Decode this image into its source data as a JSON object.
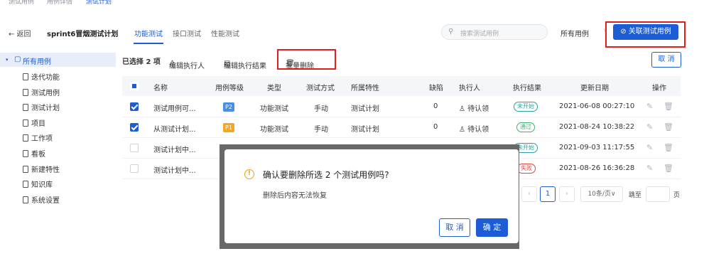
{
  "top_crumbs": [
    "测试用例",
    "用例详情",
    "测试计划"
  ],
  "header": {
    "back_label": "← 返回",
    "plan_title": "sprint6冒烟测试计划",
    "tabs": [
      "功能测试",
      "接口测试",
      "性能测试"
    ],
    "search_placeholder": "搜索测试用例",
    "filter_value": "所有用例",
    "link_button": "关联测试用例"
  },
  "sidebar": {
    "root": "所有用例",
    "items": [
      "迭代功能",
      "测试用例",
      "测试计划",
      "项目",
      "工作项",
      "看板",
      "新建特性",
      "知识库",
      "系统设置"
    ]
  },
  "toolbar": {
    "selected": "已选择 2 项",
    "edit_executor": "编辑执行人",
    "edit_result": "编辑执行结果",
    "batch_delete": "批量删除",
    "cancel": "取 消"
  },
  "table": {
    "headers": [
      "名称",
      "用例等级",
      "类型",
      "测试方式",
      "所属特性",
      "缺陷",
      "执行人",
      "执行结果",
      "更新日期",
      "操作"
    ],
    "rows": [
      {
        "name": "测试用例可...",
        "level": "P2",
        "level_color": "#4a8fe2",
        "type": "功能测试",
        "method": "手动",
        "feature": "测试计划",
        "bugs": "0",
        "executor": "待认领",
        "result": "未开始",
        "result_color": "#2aa1a6",
        "date": "2021-06-08 00:27:10",
        "checked": true
      },
      {
        "name": "从测试计划...",
        "level": "P1",
        "level_color": "#f5a623",
        "type": "功能测试",
        "method": "手动",
        "feature": "测试计划",
        "bugs": "0",
        "executor": "待认领",
        "result": "通过",
        "result_color": "#3cb371",
        "date": "2021-08-24 10:38:22",
        "checked": true
      },
      {
        "name": "测试计划中...",
        "result": "未开始",
        "result_color": "#2aa1a6",
        "date": "2021-09-03 11:17:55",
        "checked": false
      },
      {
        "name": "测试计划中...",
        "result": "失败",
        "result_color": "#e0443e",
        "date": "2021-08-26 16:36:28",
        "checked": false
      }
    ]
  },
  "pager": {
    "current": "1",
    "page_size": "10条/页",
    "jump_label": "跳至",
    "page_suffix": "页"
  },
  "dialog": {
    "title": "确认要删除所选 2 个测试用例吗?",
    "body": "删除后内容无法恢复",
    "cancel": "取 消",
    "confirm": "确 定"
  }
}
